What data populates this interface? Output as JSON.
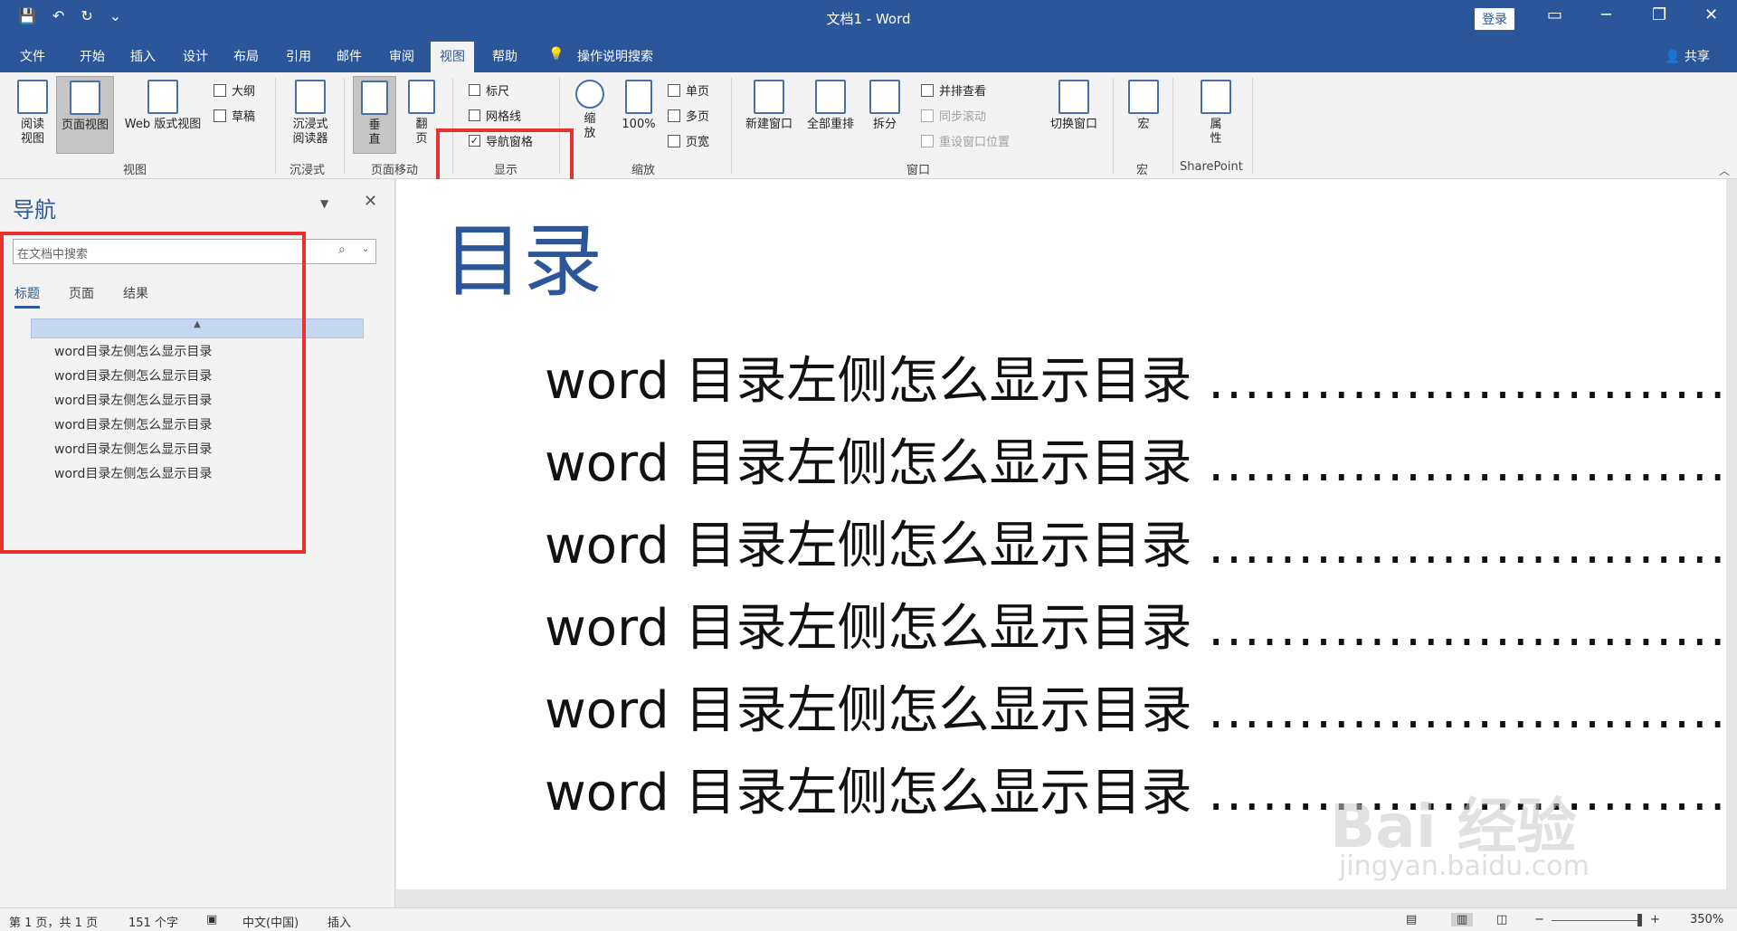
{
  "titlebar": {
    "doc_title": "文档1 - Word",
    "login": "登录",
    "qat": [
      "💾",
      "↶",
      "↻",
      "⌄"
    ],
    "share": "共享"
  },
  "tabs": [
    "文件",
    "开始",
    "插入",
    "设计",
    "布局",
    "引用",
    "邮件",
    "审阅",
    "视图",
    "帮助",
    "操作说明搜索"
  ],
  "ribbon": {
    "views": {
      "read_mode": "阅读\n视图",
      "print_layout": "页面视图",
      "web_layout": "Web 版式视图",
      "outline": "大纲",
      "draft": "草稿",
      "label": "视图"
    },
    "immersive": {
      "reader": "沉浸式\n阅读器",
      "label": "沉浸式"
    },
    "page_movement": {
      "vertical": "垂\n直",
      "side": "翻\n页",
      "label": "页面移动"
    },
    "show": {
      "ruler": "标尺",
      "gridlines": "网格线",
      "nav_pane": "导航窗格",
      "nav_pane_checked": true,
      "label": "显示"
    },
    "zoom": {
      "zoom": "缩\n放",
      "hundred": "100%",
      "one_page": "单页",
      "multi_page": "多页",
      "page_width": "页宽",
      "label": "缩放"
    },
    "window": {
      "new_window": "新建窗口",
      "arrange_all": "全部重排",
      "split": "拆分",
      "side_by_side": "并排查看",
      "sync_scroll": "同步滚动",
      "reset_pos": "重设窗口位置",
      "switch": "切换窗口",
      "label": "窗口"
    },
    "macros": {
      "macros": "宏",
      "label": "宏"
    },
    "sharepoint": {
      "properties": "属\n性",
      "label": "SharePoint"
    }
  },
  "nav": {
    "title": "导航",
    "search_placeholder": "在文档中搜索",
    "tabs": [
      "标题",
      "页面",
      "结果"
    ],
    "items": [
      "word目录左侧怎么显示目录",
      "word目录左侧怎么显示目录",
      "word目录左侧怎么显示目录",
      "word目录左侧怎么显示目录",
      "word目录左侧怎么显示目录",
      "word目录左侧怎么显示目录"
    ]
  },
  "document": {
    "toc_title": "目录",
    "toc_entries": [
      "word 目录左侧怎么显示目录",
      "word 目录左侧怎么显示目录",
      "word 目录左侧怎么显示目录",
      "word 目录左侧怎么显示目录",
      "word 目录左侧怎么显示目录",
      "word 目录左侧怎么显示目录"
    ],
    "dots": "................................................"
  },
  "statusbar": {
    "page": "第 1 页，共 1 页",
    "words": "151 个字",
    "lang": "中文(中国)",
    "mode": "插入",
    "zoom": "350%"
  },
  "watermark": {
    "logo": "Bai 经验",
    "url": "jingyan.baidu.com"
  },
  "colors": {
    "accent": "#2b579a",
    "highlight": "#e8322e"
  }
}
